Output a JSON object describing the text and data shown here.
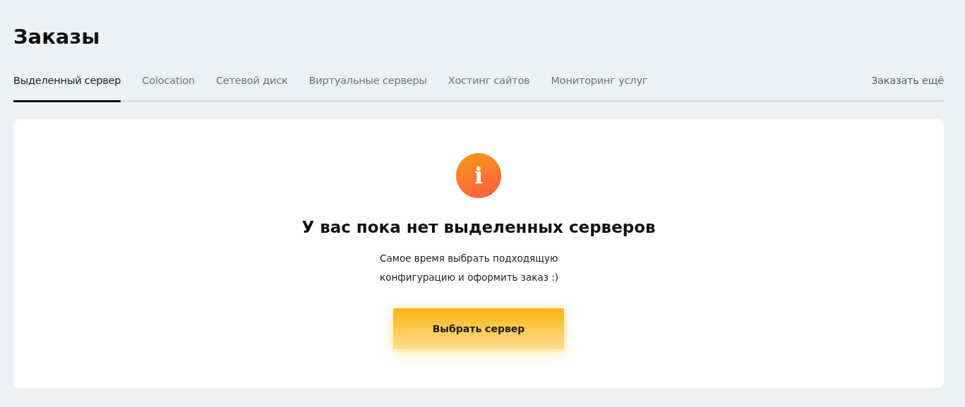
{
  "page": {
    "title": "Заказы"
  },
  "tabs": [
    {
      "label": "Выделенный сервер",
      "selected": true
    },
    {
      "label": "Colocation",
      "selected": false
    },
    {
      "label": "Сетевой диск",
      "selected": false
    },
    {
      "label": "Виртуальные серверы",
      "selected": false
    },
    {
      "label": "Хостинг сайтов",
      "selected": false
    },
    {
      "label": "Мониторинг услуг",
      "selected": false
    }
  ],
  "order_more_link": "Заказать ещё",
  "empty_state": {
    "icon_letter": "i",
    "heading": "У вас пока нет выделенных серверов",
    "message": "Самое время выбрать подходящую конфигурацию и оформить заказ :)",
    "button": "Выбрать сервер"
  }
}
